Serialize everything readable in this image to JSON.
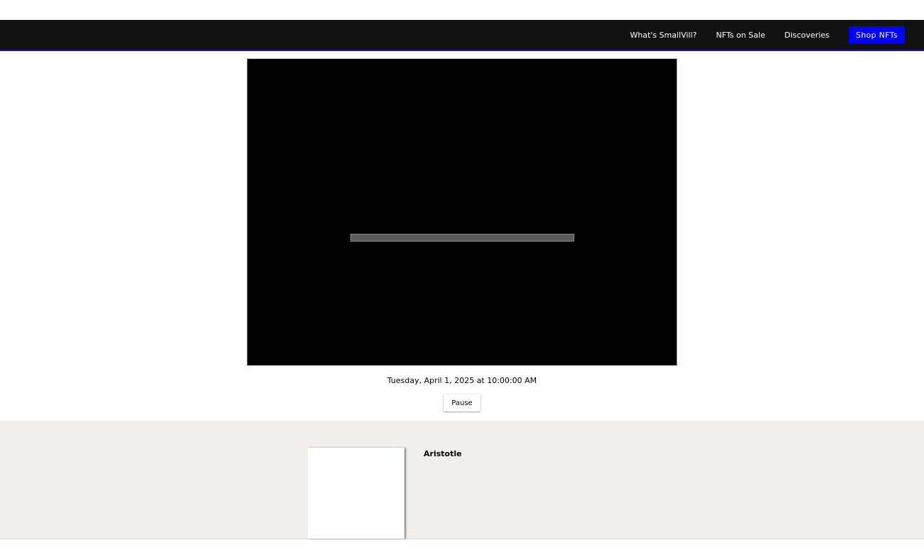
{
  "nav": {
    "links": [
      {
        "label": "What's SmallVill?"
      },
      {
        "label": "NFTs on Sale"
      },
      {
        "label": "Discoveries"
      }
    ],
    "cta_label": "Shop NFTs"
  },
  "simulation": {
    "timestamp": "Tuesday, April 1, 2025 at 10:00:00 AM",
    "pause_label": "Pause"
  },
  "agent": {
    "name": "Aristotle"
  },
  "colors": {
    "topbar_bg": "#121212",
    "cta_bg": "#0000ff",
    "panel_bg": "#f2efeb"
  }
}
